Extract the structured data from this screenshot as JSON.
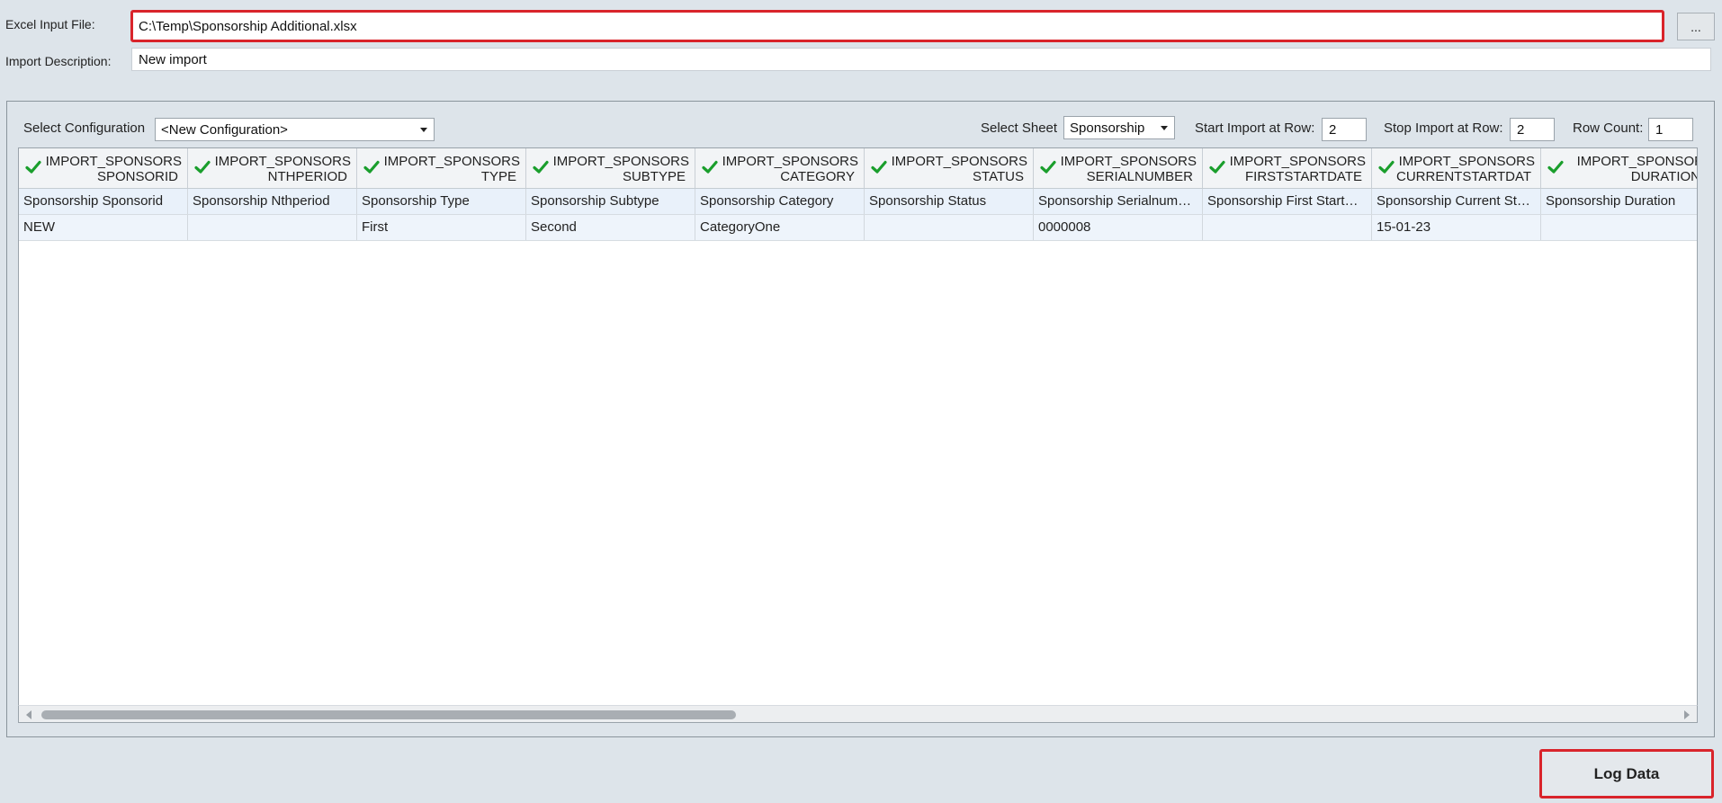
{
  "excel_input": {
    "label": "Excel Input File:",
    "value": "C:\\Temp\\Sponsorship Additional.xlsx",
    "browse_label": "..."
  },
  "import_description": {
    "label": "Import Description:",
    "value": "New import"
  },
  "config": {
    "label": "Select Configuration",
    "value": "<New Configuration>"
  },
  "sheet": {
    "label": "Select Sheet",
    "value": "Sponsorship"
  },
  "start_row": {
    "label": "Start Import at Row:",
    "value": "2"
  },
  "stop_row": {
    "label": "Stop Import at Row:",
    "value": "2"
  },
  "row_count": {
    "label": "Row Count:",
    "value": "1"
  },
  "grid": {
    "columns": [
      {
        "line1": "IMPORT_SPONSORS",
        "line2": "SPONSORID",
        "icon": "check-icon"
      },
      {
        "line1": "IMPORT_SPONSORS",
        "line2": "NTHPERIOD",
        "icon": "check-icon"
      },
      {
        "line1": "IMPORT_SPONSORS",
        "line2": "TYPE",
        "icon": "check-icon"
      },
      {
        "line1": "IMPORT_SPONSORS",
        "line2": "SUBTYPE",
        "icon": "check-icon"
      },
      {
        "line1": "IMPORT_SPONSORS",
        "line2": "CATEGORY",
        "icon": "check-icon"
      },
      {
        "line1": "IMPORT_SPONSORS",
        "line2": "STATUS",
        "icon": "check-icon"
      },
      {
        "line1": "IMPORT_SPONSORS",
        "line2": "SERIALNUMBER",
        "icon": "check-icon"
      },
      {
        "line1": "IMPORT_SPONSORS",
        "line2": "FIRSTSTARTDATE",
        "icon": "check-icon"
      },
      {
        "line1": "IMPORT_SPONSORS",
        "line2": "CURRENTSTARTDAT",
        "icon": "check-icon"
      },
      {
        "line1": "IMPORT_SPONSOR",
        "line2": "DURATION",
        "icon": "check-icon"
      }
    ],
    "descriptions": [
      "Sponsorship Sponsorid",
      "Sponsorship Nthperiod",
      "Sponsorship Type",
      "Sponsorship Subtype",
      "Sponsorship Category",
      "Sponsorship Status",
      "Sponsorship Serialnum…",
      "Sponsorship First Start…",
      "Sponsorship Current St…",
      "Sponsorship Duration"
    ],
    "rows": [
      [
        "NEW",
        "",
        "First",
        "Second",
        "CategoryOne",
        "",
        "0000008",
        "",
        "15-01-23",
        ""
      ]
    ]
  },
  "log_button": {
    "label": "Log Data"
  },
  "colors": {
    "highlight": "#d9242b",
    "check": "#1a9e2c",
    "background": "#dde4ea"
  }
}
